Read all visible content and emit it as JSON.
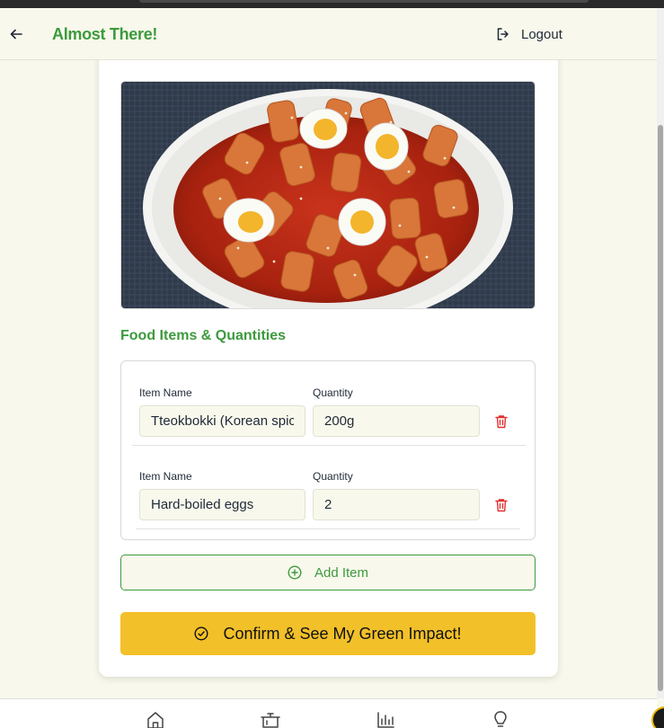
{
  "header": {
    "title": "Almost There!",
    "logout_label": "Logout"
  },
  "food_image": {
    "alt": "Tteokbokki with hard-boiled eggs on a white plate"
  },
  "section_title": "Food Items & Quantities",
  "items": [
    {
      "name_label": "Item Name",
      "qty_label": "Quantity",
      "name_value": "Tteokbokki (Korean spicy rice cakes)",
      "qty_value": "200g"
    },
    {
      "name_label": "Item Name",
      "qty_label": "Quantity",
      "name_value": "Hard-boiled eggs",
      "qty_value": "2"
    }
  ],
  "add_item_label": "Add Item",
  "confirm_label": "Confirm & See My Green Impact!",
  "bottom_nav": [
    "home-icon",
    "pot-icon",
    "bar-chart-icon",
    "lightbulb-icon"
  ],
  "colors": {
    "brand_green": "#3d9a3d",
    "confirm_yellow": "#f2c029",
    "background": "#f8f8ec",
    "delete_red": "#e0302f"
  }
}
